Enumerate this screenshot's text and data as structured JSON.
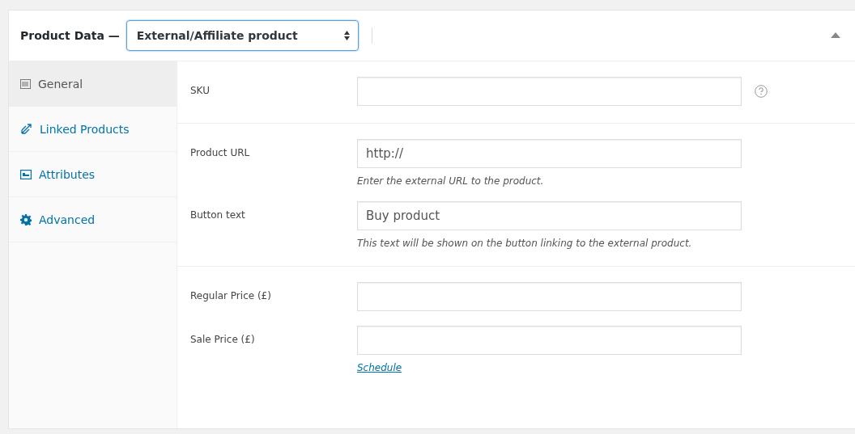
{
  "header": {
    "title": "Product Data —",
    "product_type": "External/Affiliate product",
    "collapsed": false
  },
  "tabs": [
    {
      "label": "General",
      "selected": true
    },
    {
      "label": "Linked Products",
      "selected": false
    },
    {
      "label": "Attributes",
      "selected": false
    },
    {
      "label": "Advanced",
      "selected": false
    }
  ],
  "sections": [
    {
      "fields": [
        {
          "label": "SKU",
          "help": true
        }
      ]
    },
    {
      "fields": [
        {
          "label": "Product URL",
          "value": "http://",
          "description": "Enter the external URL to the product."
        },
        {
          "label": "Button text",
          "value": "Buy product",
          "description": "This text will be shown on the button linking to the external product."
        }
      ]
    },
    {
      "fields": [
        {
          "label": "Regular Price (£)"
        },
        {
          "label": "Sale Price (£)",
          "link": "Schedule"
        }
      ]
    }
  ]
}
